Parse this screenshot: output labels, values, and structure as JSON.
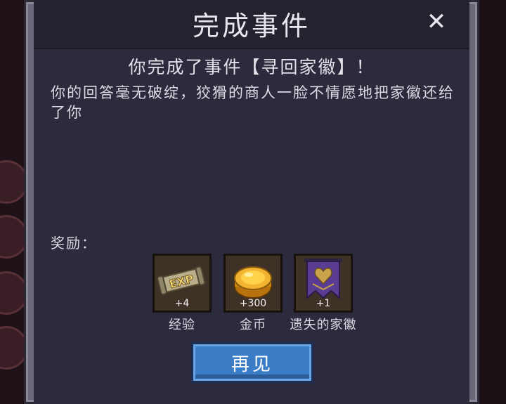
{
  "dialog": {
    "title": "完成事件",
    "event_line": "你完成了事件【寻回家徽】！",
    "description": "你的回答毫无破绽，狡猾的商人一脸不情愿地把家徽还给了你",
    "rewards_label": "奖励：",
    "rewards": [
      {
        "icon": "exp-scroll-icon",
        "count": "+4",
        "name": "经验"
      },
      {
        "icon": "gold-coin-icon",
        "count": "+300",
        "name": "金币"
      },
      {
        "icon": "family-crest-banner-icon",
        "count": "+1",
        "name": "遗失的家徽"
      }
    ],
    "button_label": "再见",
    "close_icon": "close-icon"
  },
  "colors": {
    "panel": "#2c2b3d",
    "titlebar": "#23222f",
    "button": "#3b7cc6"
  }
}
